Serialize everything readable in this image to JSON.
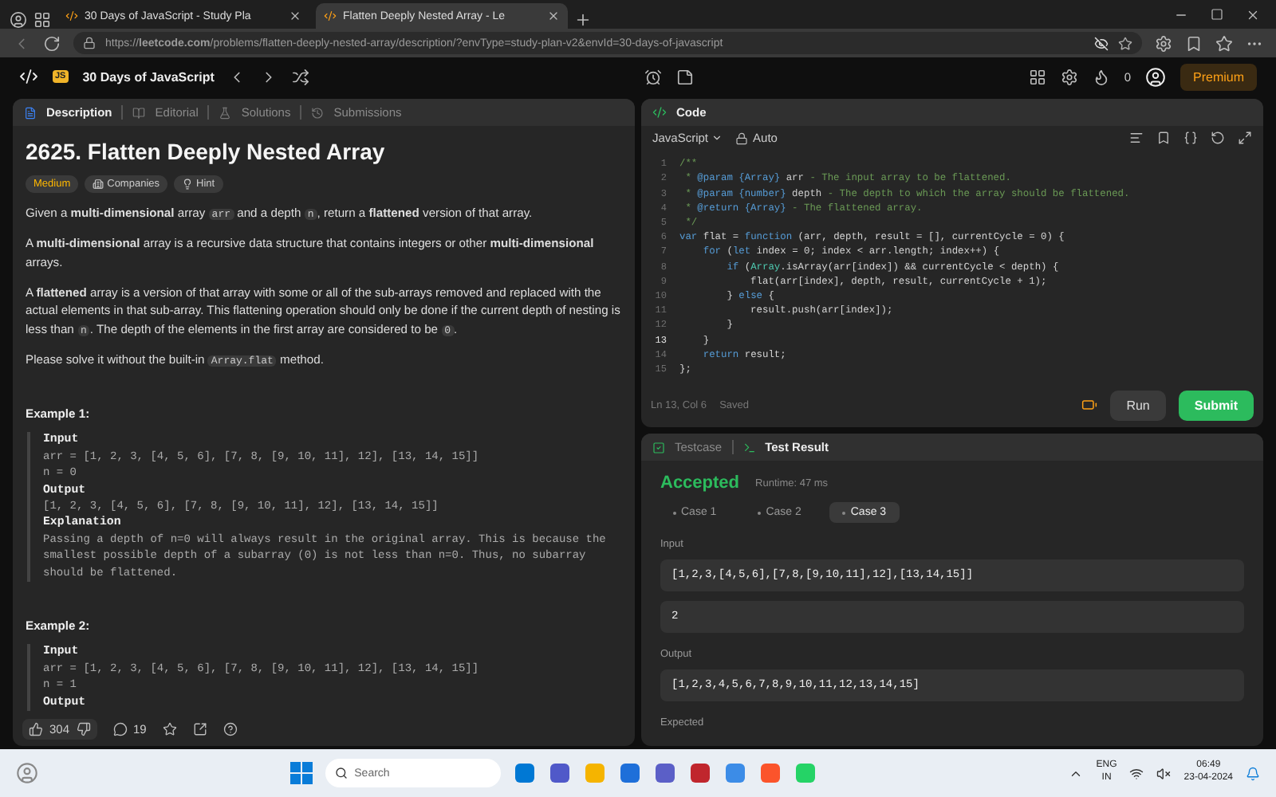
{
  "browser": {
    "tabs": [
      {
        "title": "30 Days of JavaScript - Study Pla",
        "selected": false
      },
      {
        "title": "Flatten Deeply Nested Array - Le",
        "selected": true
      }
    ],
    "address": "https://**leetcode.com**/problems/flatten-deeply-nested-array/description/?envType=study-plan-v2&envId=30-days-of-javascript"
  },
  "nav": {
    "badge": "JS",
    "study_plan": "30 Days of JavaScript",
    "streak": "0",
    "premium": "Premium"
  },
  "description_panel": {
    "tabs": [
      {
        "label": "Description",
        "selected": true
      },
      {
        "label": "Editorial",
        "selected": false
      },
      {
        "label": "Solutions",
        "selected": false
      },
      {
        "label": "Submissions",
        "selected": false
      }
    ],
    "title": "2625. Flatten Deeply Nested Array",
    "difficulty": "Medium",
    "tags": [
      {
        "kind": "companies",
        "label": "Companies"
      },
      {
        "kind": "hint",
        "label": "Hint"
      }
    ],
    "paragraphs": [
      [
        {
          "kind": "text",
          "text": "Given a **multi-dimensional** array "
        },
        {
          "kind": "code",
          "text": "arr"
        },
        {
          "kind": "text",
          "text": " and a depth "
        },
        {
          "kind": "code",
          "text": "n"
        },
        {
          "kind": "text",
          "text": ", return a **flattened** version of that array."
        }
      ],
      [
        {
          "kind": "text",
          "text": "A **multi-dimensional** array is a recursive data structure that contains integers or other **multi-dimensional** arrays."
        }
      ],
      [
        {
          "kind": "text",
          "text": "A **flattened** array is a version of that array with some or all of the sub-arrays removed and replaced with the actual elements in that sub-array. This flattening operation should only be done if the current depth of nesting is less than "
        },
        {
          "kind": "code",
          "text": "n"
        },
        {
          "kind": "text",
          "text": ". The depth of the elements in the first array are considered to be "
        },
        {
          "kind": "code",
          "text": "0"
        },
        {
          "kind": "text",
          "text": "."
        }
      ],
      [
        {
          "kind": "text",
          "text": "Please solve it without the built-in "
        },
        {
          "kind": "code",
          "text": "Array.flat"
        },
        {
          "kind": "text",
          "text": " method."
        }
      ]
    ],
    "examples": [
      {
        "title": "Example 1:",
        "blocks": [
          {
            "label": "Input",
            "lines": [
              "arr = [1, 2, 3, [4, 5, 6], [7, 8, [9, 10, 11], 12], [13, 14, 15]]",
              "n = 0"
            ]
          },
          {
            "label": "Output",
            "lines": [
              "[1, 2, 3, [4, 5, 6], [7, 8, [9, 10, 11], 12], [13, 14, 15]]"
            ]
          },
          {
            "label": "Explanation",
            "lines": [
              "Passing a depth of n=0 will always result in the original array. This is because the smallest possible depth of a subarray (0) is not less than n=0. Thus, no subarray should be flattened."
            ]
          }
        ]
      },
      {
        "title": "Example 2:",
        "blocks": [
          {
            "label": "Input",
            "lines": [
              "arr = [1, 2, 3, [4, 5, 6], [7, 8, [9, 10, 11], 12], [13, 14, 15]]",
              "n = 1"
            ]
          },
          {
            "label": "Output"
          }
        ]
      }
    ],
    "footer": {
      "likes": "304",
      "comments": "19"
    }
  },
  "code_panel": {
    "title": "Code",
    "language": "JavaScript",
    "mode": "Auto",
    "lines": [
      {
        "number": "1",
        "current": false,
        "tokens": [
          {
            "kind": "comment",
            "text": "/**"
          }
        ]
      },
      {
        "number": "2",
        "current": false,
        "tokens": [
          {
            "kind": "comment",
            "text": " * "
          },
          {
            "kind": "tag",
            "text": "@param {Array}"
          },
          {
            "kind": "name",
            "text": " arr"
          },
          {
            "kind": "comment",
            "text": " - The input array to be flattened."
          }
        ]
      },
      {
        "number": "3",
        "current": false,
        "tokens": [
          {
            "kind": "comment",
            "text": " * "
          },
          {
            "kind": "tag",
            "text": "@param {number}"
          },
          {
            "kind": "name",
            "text": " depth"
          },
          {
            "kind": "comment",
            "text": " - The depth to which the array should be flattened."
          }
        ]
      },
      {
        "number": "4",
        "current": false,
        "tokens": [
          {
            "kind": "comment",
            "text": " * "
          },
          {
            "kind": "tag",
            "text": "@return {Array}"
          },
          {
            "kind": "comment",
            "text": " - The flattened array."
          }
        ]
      },
      {
        "number": "5",
        "current": false,
        "tokens": [
          {
            "kind": "comment",
            "text": " */"
          }
        ]
      },
      {
        "number": "6",
        "current": false,
        "tokens": [
          {
            "kind": "keyword",
            "text": "var"
          },
          {
            "kind": "plain",
            "text": " flat = "
          },
          {
            "kind": "keyword",
            "text": "function"
          },
          {
            "kind": "plain",
            "text": " (arr, depth, result = [], currentCycle = 0) {"
          }
        ]
      },
      {
        "number": "7",
        "current": false,
        "tokens": [
          {
            "kind": "keyword",
            "text": "    for"
          },
          {
            "kind": "plain",
            "text": " ("
          },
          {
            "kind": "keyword",
            "text": "let"
          },
          {
            "kind": "plain",
            "text": " index = 0; index < arr.length; index++) {"
          }
        ]
      },
      {
        "number": "8",
        "current": false,
        "tokens": [
          {
            "kind": "keyword",
            "text": "        if"
          },
          {
            "kind": "plain",
            "text": " ("
          },
          {
            "kind": "type",
            "text": "Array"
          },
          {
            "kind": "plain",
            "text": ".isArray(arr[index]) && currentCycle < depth) {"
          }
        ]
      },
      {
        "number": "9",
        "current": false,
        "tokens": [
          {
            "kind": "plain",
            "text": "            flat(arr[index], depth, result, currentCycle + 1);"
          }
        ]
      },
      {
        "number": "10",
        "current": false,
        "tokens": [
          {
            "kind": "plain",
            "text": "        } "
          },
          {
            "kind": "keyword",
            "text": "else"
          },
          {
            "kind": "plain",
            "text": " {"
          }
        ]
      },
      {
        "number": "11",
        "current": false,
        "tokens": [
          {
            "kind": "plain",
            "text": "            result.push(arr[index]);"
          }
        ]
      },
      {
        "number": "12",
        "current": false,
        "tokens": [
          {
            "kind": "plain",
            "text": "        }"
          }
        ]
      },
      {
        "number": "13",
        "current": true,
        "tokens": [
          {
            "kind": "plain",
            "text": "    }"
          }
        ]
      },
      {
        "number": "14",
        "current": false,
        "tokens": [
          {
            "kind": "keyword",
            "text": "    return"
          },
          {
            "kind": "plain",
            "text": " result;"
          }
        ]
      },
      {
        "number": "15",
        "current": false,
        "tokens": [
          {
            "kind": "plain",
            "text": "};"
          }
        ]
      }
    ],
    "cursor": "Ln 13, Col 6",
    "save_state": "Saved",
    "run": "Run",
    "submit": "Submit"
  },
  "test_panel": {
    "tabs": [
      {
        "label": "Testcase",
        "selected": false
      },
      {
        "label": "Test Result",
        "selected": true
      }
    ],
    "status": "Accepted",
    "runtime": "Runtime: 47 ms",
    "cases": [
      {
        "label": "Case 1",
        "selected": false
      },
      {
        "label": "Case 2",
        "selected": false
      },
      {
        "label": "Case 3",
        "selected": true
      }
    ],
    "sections": [
      {
        "label": "Input",
        "values": [
          "[1,2,3,[4,5,6],[7,8,[9,10,11],12],[13,14,15]]",
          "2"
        ]
      },
      {
        "label": "Output",
        "values": [
          "[1,2,3,4,5,6,7,8,9,10,11,12,13,14,15]"
        ]
      },
      {
        "label": "Expected"
      }
    ]
  },
  "taskbar": {
    "search": "Search",
    "language": "ENG",
    "region": "IN",
    "time": "06:49",
    "date": "23-04-2024"
  }
}
